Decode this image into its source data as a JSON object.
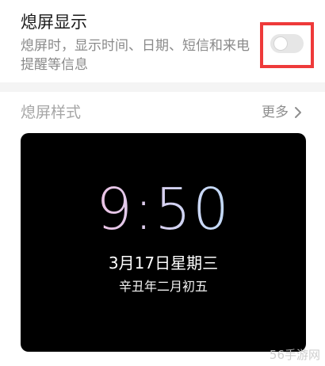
{
  "aod_setting": {
    "title": "熄屏显示",
    "description": "熄屏时，显示时间、日期、短信和来电提醒等信息",
    "toggle_state": "off"
  },
  "style_section": {
    "header": "熄屏样式",
    "more_label": "更多"
  },
  "preview": {
    "time": "9:50",
    "date": "3月17日星期三",
    "lunar": "辛丑年二月初五"
  },
  "watermark": "56手游网",
  "colors": {
    "highlight_border": "#ee3a3a",
    "toggle_off_bg": "#e6e6e6",
    "preview_bg": "#000000"
  }
}
